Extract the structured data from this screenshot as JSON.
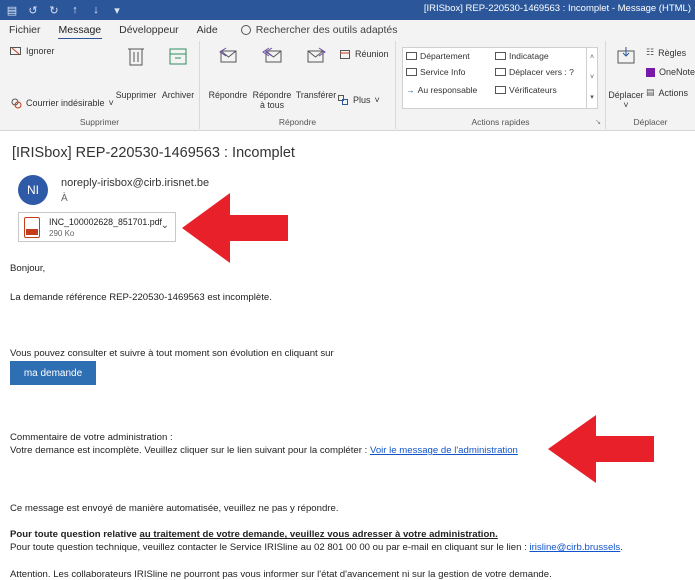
{
  "window": {
    "title": "[IRISbox] REP-220530-1469563 : Incomplet  -  Message (HTML)"
  },
  "tabs": [
    {
      "label": "Fichier"
    },
    {
      "label": "Message"
    },
    {
      "label": "Développeur"
    },
    {
      "label": "Aide"
    }
  ],
  "search": {
    "label": "Rechercher des outils adaptés"
  },
  "ribbon": {
    "supprimer": {
      "ignorer": "Ignorer",
      "courrier": "Courrier indésirable",
      "supprimer": "Supprimer",
      "archiver": "Archiver",
      "group": "Supprimer"
    },
    "repondre": {
      "repondre": "Répondre",
      "repondre_tous_1": "Répondre",
      "repondre_tous_2": "à tous",
      "transferer": "Transférer",
      "reunion": "Réunion",
      "plus": "Plus",
      "group": "Répondre"
    },
    "actions_rapides": {
      "departement": "Département",
      "service_info": "Service Info",
      "au_responsable": "Au responsable",
      "indicatage": "Indicatage",
      "deplacer_vers": "Déplacer vers : ?",
      "verificateurs": "Vérificateurs",
      "group": "Actions rapides"
    },
    "deplacer": {
      "deplacer": "Déplacer",
      "regles": "Règles",
      "onenote": "OneNote",
      "actions": "Actions",
      "group": "Déplacer"
    }
  },
  "message": {
    "subject": "[IRISbox] REP-220530-1469563 : Incomplet",
    "avatar_initials": "NI",
    "sender": "noreply-irisbox@cirb.irisnet.be",
    "to_label": "À",
    "attachment": {
      "name": "INC_100002628_851701.pdf",
      "size": "290 Ko"
    },
    "greeting": "Bonjour,",
    "line1": "La demande référence REP-220530-1469563 est incomplète.",
    "line2": "Vous pouvez consulter et suivre à tout moment son évolution en cliquant sur",
    "button": "ma demande",
    "comment_title": "Commentaire de votre administration :",
    "comment_text": "Votre demance est incomplète. Veuillez cliquer sur le lien suivant pour la compléter : ",
    "comment_link": "Voir le message de l'administration",
    "auto": "Ce message est envoyé de manière automatisée, veuillez ne pas y répondre.",
    "q1_bold": "Pour toute question relative ",
    "q1_underline": "au traitement de votre demande, veuillez vous adresser à votre administration.",
    "q2_text": "Pour toute question technique, veuillez contacter le Service IRISline au 02 801 00 00 ou par e-mail en cliquant sur le lien : ",
    "q2_link": "irisline@cirb.brussels",
    "q2_end": ".",
    "attention": "Attention. Les collaborateurs IRISline ne pourront pas vous informer sur l'état d'avancement ni sur la gestion de votre demande."
  },
  "colors": {
    "titlebar": "#2b579a",
    "button": "#2e6eb3",
    "arrow": "#e8202a",
    "link": "#1155cc"
  }
}
